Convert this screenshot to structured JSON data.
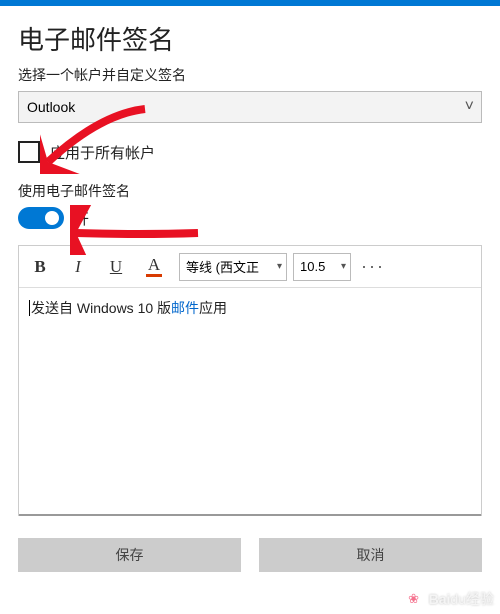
{
  "header": {
    "title": "电子邮件签名",
    "subtitle": "选择一个帐户并自定义签名"
  },
  "account_select": {
    "value": "Outlook"
  },
  "apply_all": {
    "label": "应用于所有帐户",
    "checked": false
  },
  "use_signature": {
    "label": "使用电子邮件签名"
  },
  "toggle": {
    "state_label": "开",
    "on": true
  },
  "toolbar": {
    "bold": "B",
    "italic": "I",
    "underline": "U",
    "color": "A",
    "font": "等线 (西文正",
    "size": "10.5",
    "more": "···"
  },
  "editor": {
    "pre_text": "发送自 Windows 10 版",
    "link_text": "邮件",
    "post_text": "应用"
  },
  "buttons": {
    "save": "保存",
    "cancel": "取消"
  },
  "watermark": {
    "brand_a": "Bai",
    "brand_b": "du",
    "suffix": "经验"
  }
}
